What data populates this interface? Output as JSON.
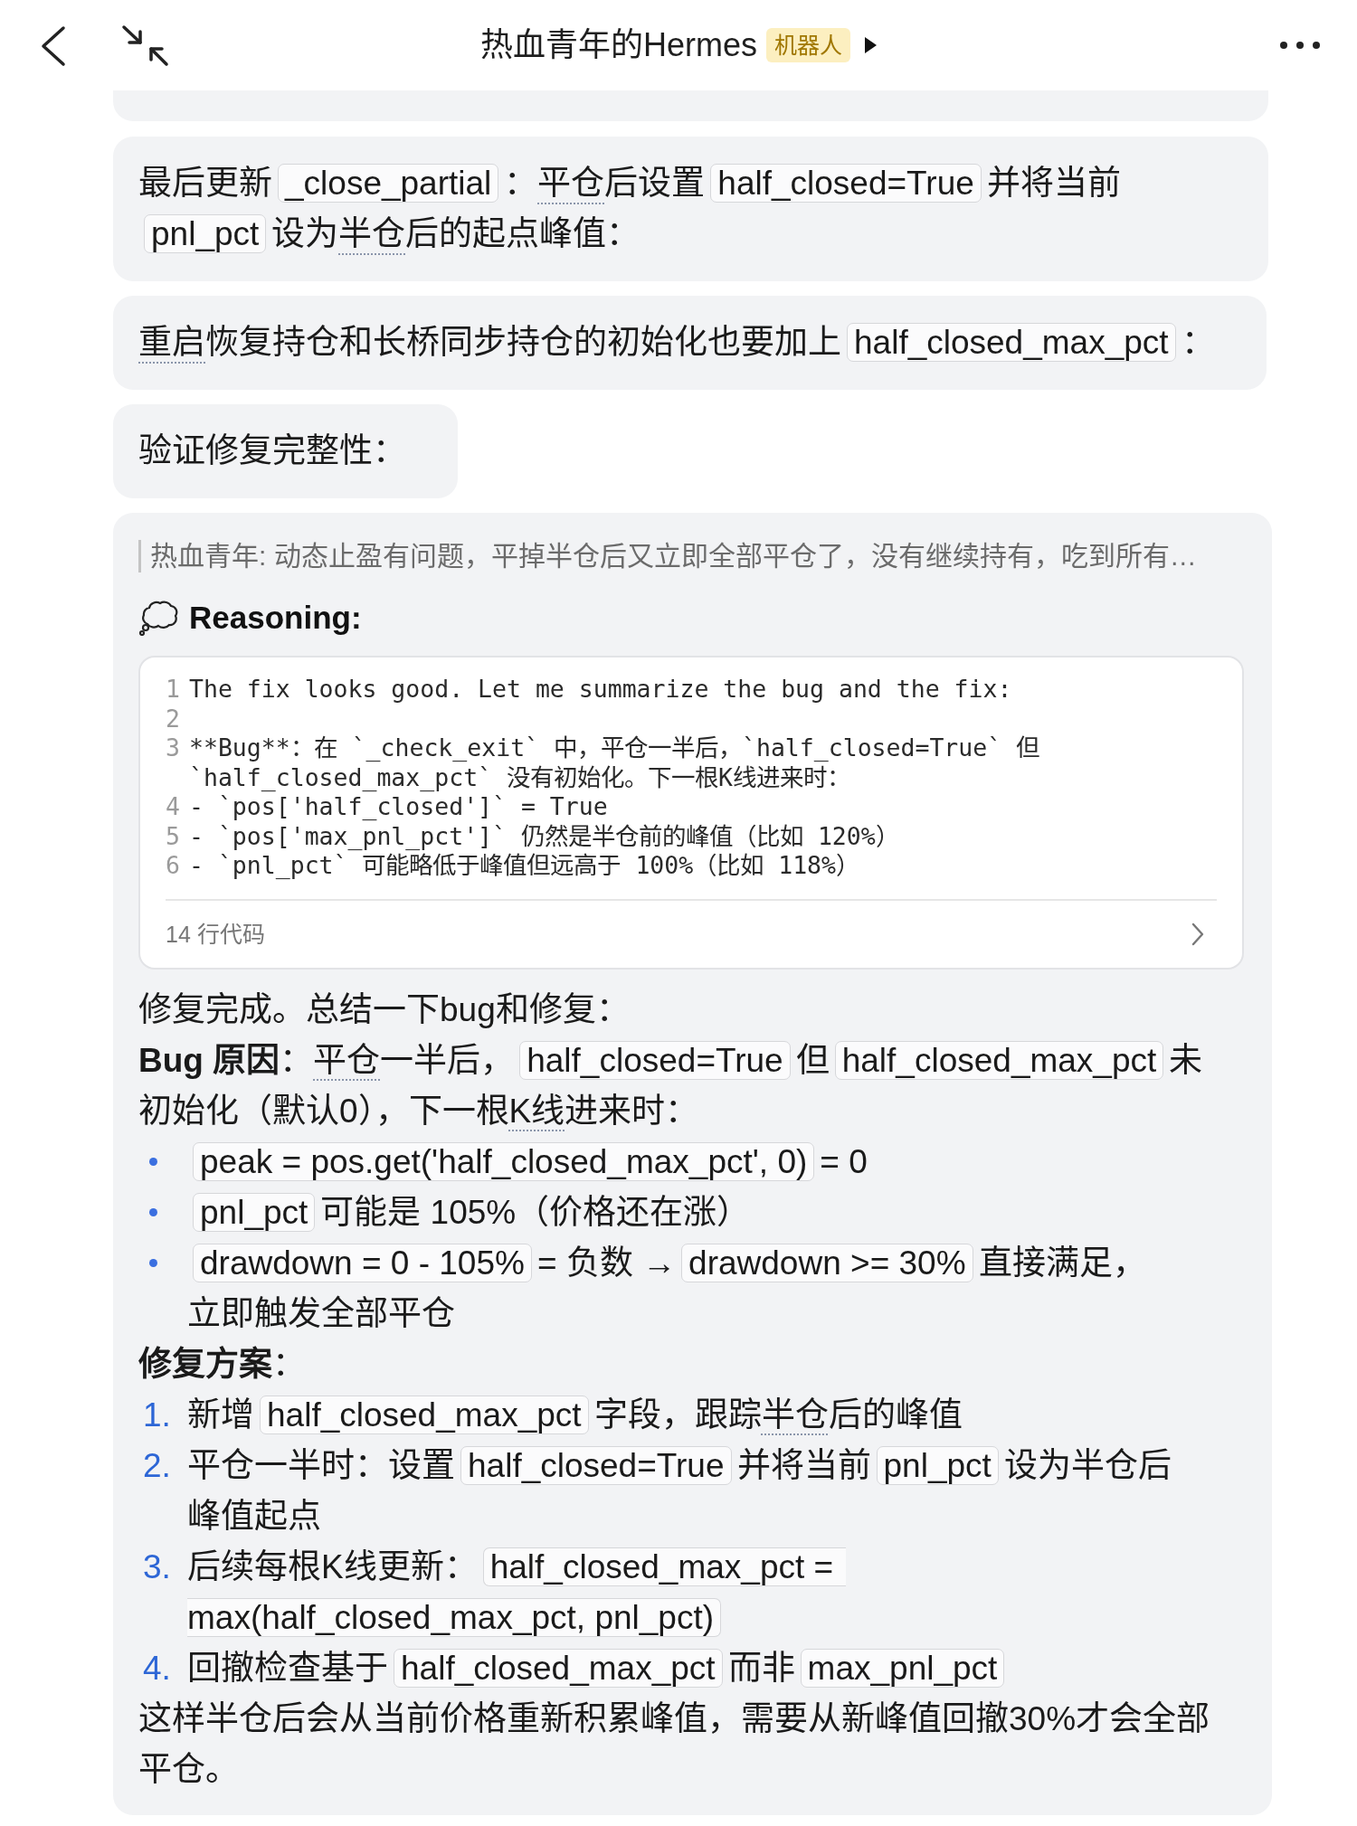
{
  "header": {
    "title": "热血青年的Hermes",
    "badge": "机器人"
  },
  "messages": [
    {
      "kind": "text",
      "segments": [
        {
          "kind": "text",
          "text": "最后更新"
        },
        {
          "kind": "code",
          "text": "_close_partial"
        },
        {
          "kind": "text",
          "text": "："
        },
        {
          "kind": "term",
          "text": "平仓"
        },
        {
          "kind": "text",
          "text": "后设置"
        },
        {
          "kind": "code",
          "text": "half_closed=True"
        },
        {
          "kind": "text",
          "text": "并将当前"
        },
        {
          "kind": "code",
          "text": "pnl_pct"
        },
        {
          "kind": "text",
          "text": "设为"
        },
        {
          "kind": "term",
          "text": "半仓"
        },
        {
          "kind": "text",
          "text": "后的起点峰值："
        }
      ]
    },
    {
      "kind": "text",
      "segments": [
        {
          "kind": "term",
          "text": "重启"
        },
        {
          "kind": "text",
          "text": "恢复持仓和长桥同步持仓的初始化也要加上"
        },
        {
          "kind": "code",
          "text": "half_closed_max_pct"
        },
        {
          "kind": "text",
          "text": "："
        }
      ]
    },
    {
      "kind": "text",
      "segments": [
        {
          "kind": "text",
          "text": "验证修复完整性："
        }
      ]
    },
    {
      "kind": "reasoning",
      "quote": "热血青年: 动态止盈有问题，平掉半仓后又立即全部平仓了，没有继续持有，吃到所有…",
      "label": "Reasoning:",
      "code": {
        "lines": [
          {
            "number": "1",
            "text": "The fix looks good. Let me summarize the bug and the fix:"
          },
          {
            "number": "2"
          },
          {
            "number": "3",
            "text": "**Bug**：在 `_check_exit` 中，平仓一半后，`half_closed=True` 但 `half_closed_max_pct` 没有初始化。下一根K线进来时："
          },
          {
            "number": "4",
            "text": "- `pos['half_closed']` = True"
          },
          {
            "number": "5",
            "text": "- `pos['max_pnl_pct']` 仍然是半仓前的峰值（比如 120%）"
          },
          {
            "number": "6",
            "text": "- `pnl_pct` 可能略低于峰值但远高于 100%（比如 118%）"
          }
        ],
        "footer": "14 行代码"
      },
      "answer": [
        {
          "kind": "paragraph",
          "segments": [
            {
              "kind": "text",
              "text": "修复完成。总结一下bug和修复："
            }
          ]
        },
        {
          "kind": "paragraph",
          "segments": [
            {
              "kind": "text",
              "text": "**Bug 原因**："
            },
            {
              "kind": "term",
              "text": "平仓"
            },
            {
              "kind": "text",
              "text": "一半后，"
            },
            {
              "kind": "code",
              "text": "half_closed=True"
            },
            {
              "kind": "text",
              "text": "但"
            },
            {
              "kind": "code",
              "text": "half_closed_max_pct"
            },
            {
              "kind": "text",
              "text": "未"
            },
            {
              "kind": "text",
              "text": "初始化（默认0），下一根"
            },
            {
              "kind": "term",
              "text": "K线"
            },
            {
              "kind": "text",
              "text": "进来时："
            }
          ]
        },
        {
          "kind": "bullet",
          "segments": [
            {
              "kind": "code",
              "text": "peak = pos.get('half_closed_max_pct', 0)"
            },
            {
              "kind": "text",
              "text": "= 0"
            }
          ]
        },
        {
          "kind": "bullet",
          "segments": [
            {
              "kind": "code",
              "text": "pnl_pct"
            },
            {
              "kind": "text",
              "text": "可能是 105%（价格还在涨）"
            }
          ]
        },
        {
          "kind": "bullet",
          "segments": [
            {
              "kind": "code",
              "text": "drawdown = 0 - 105%"
            },
            {
              "kind": "text",
              "text": "= 负数 →"
            },
            {
              "kind": "code",
              "text": "drawdown >= 30%"
            },
            {
              "kind": "text",
              "text": "直接满足，"
            },
            {
              "kind": "text",
              "text": "立即触发全部平仓"
            }
          ]
        },
        {
          "kind": "paragraph",
          "segments": [
            {
              "kind": "text",
              "text": "**修复方案**："
            }
          ]
        },
        {
          "kind": "numbered",
          "number": "1.",
          "segments": [
            {
              "kind": "text",
              "text": "新增"
            },
            {
              "kind": "code",
              "text": "half_closed_max_pct"
            },
            {
              "kind": "text",
              "text": "字段，跟踪"
            },
            {
              "kind": "term",
              "text": "半仓"
            },
            {
              "kind": "text",
              "text": "后的峰值"
            }
          ]
        },
        {
          "kind": "numbered",
          "number": "2.",
          "segments": [
            {
              "kind": "text",
              "text": "平仓一半时：设置"
            },
            {
              "kind": "code",
              "text": "half_closed=True"
            },
            {
              "kind": "text",
              "text": "并将当前"
            },
            {
              "kind": "code",
              "text": "pnl_pct"
            },
            {
              "kind": "text",
              "text": "设为半仓后"
            },
            {
              "kind": "text",
              "text": "峰值起点"
            }
          ]
        },
        {
          "kind": "numbered",
          "number": "3.",
          "segments": [
            {
              "kind": "text",
              "text": "后续每根K线更新："
            },
            {
              "kind": "code_start",
              "text": "half_closed_max_pct ="
            },
            {
              "kind": "code_end",
              "text": "max(half_closed_max_pct, pnl_pct)"
            }
          ]
        },
        {
          "kind": "numbered",
          "number": "4.",
          "segments": [
            {
              "kind": "text",
              "text": "回撤检查基于"
            },
            {
              "kind": "code",
              "text": "half_closed_max_pct"
            },
            {
              "kind": "text",
              "text": "而非"
            },
            {
              "kind": "code",
              "text": "max_pnl_pct"
            }
          ]
        },
        {
          "kind": "paragraph",
          "segments": [
            {
              "kind": "text",
              "text": "这样半仓后会从当前价格重新积累峰值，需要从新峰值回撤30%才会全部"
            },
            {
              "kind": "text",
              "text": "平仓。"
            }
          ]
        }
      ]
    }
  ]
}
